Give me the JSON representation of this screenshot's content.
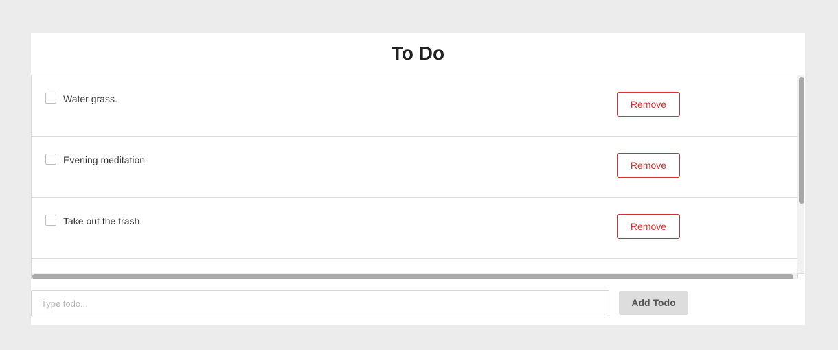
{
  "app": {
    "title": "To Do"
  },
  "todos": [
    {
      "text": "Water grass.",
      "checked": false,
      "remove_label": "Remove"
    },
    {
      "text": "Evening meditation",
      "checked": false,
      "remove_label": "Remove"
    },
    {
      "text": "Take out the trash.",
      "checked": false,
      "remove_label": "Remove"
    }
  ],
  "input": {
    "value": "",
    "placeholder": "Type todo..."
  },
  "add_button": {
    "label": "Add Todo"
  },
  "colors": {
    "page_background": "#ececec",
    "card_background": "#ffffff",
    "remove_accent": "#d32f2f",
    "add_button_background": "#dddddd",
    "divider": "#dcdcdc"
  }
}
